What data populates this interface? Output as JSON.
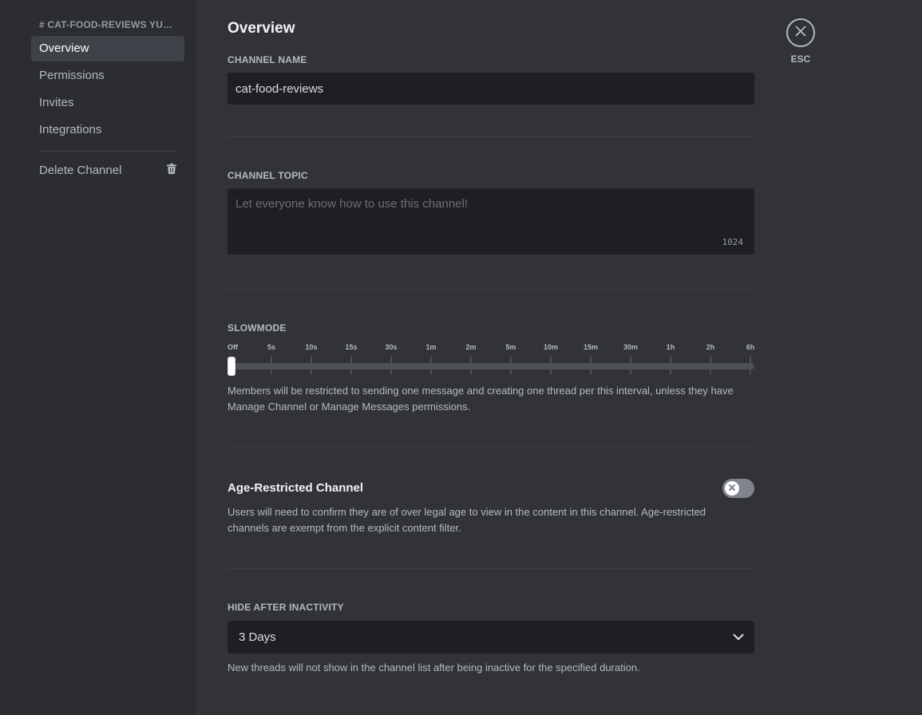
{
  "sidebar": {
    "header": "# CAT-FOOD-REVIEWS YUMMY",
    "items": [
      {
        "label": "Overview",
        "active": true
      },
      {
        "label": "Permissions"
      },
      {
        "label": "Invites"
      },
      {
        "label": "Integrations"
      }
    ],
    "delete_label": "Delete Channel"
  },
  "main": {
    "title": "Overview",
    "channel_name": {
      "label": "CHANNEL NAME",
      "value": "cat-food-reviews"
    },
    "channel_topic": {
      "label": "CHANNEL TOPIC",
      "placeholder": "Let everyone know how to use this channel!",
      "counter": "1024"
    },
    "slowmode": {
      "label": "SLOWMODE",
      "ticks": [
        "Off",
        "5s",
        "10s",
        "15s",
        "30s",
        "1m",
        "2m",
        "5m",
        "10m",
        "15m",
        "30m",
        "1h",
        "2h",
        "6h"
      ],
      "selected_index": 0,
      "description": "Members will be restricted to sending one message and creating one thread per this interval, unless they have Manage Channel or Manage Messages permissions."
    },
    "age_restricted": {
      "title": "Age-Restricted Channel",
      "enabled": false,
      "description": "Users will need to confirm they are of over legal age to view in the content in this channel. Age-restricted channels are exempt from the explicit content filter."
    },
    "hide_after_inactivity": {
      "label": "HIDE AFTER INACTIVITY",
      "value": "3 Days",
      "description": "New threads will not show in the channel list after being inactive for the specified duration."
    }
  },
  "close": {
    "label": "ESC"
  },
  "colors": {
    "background": "#313338",
    "sidebar": "#2b2d31",
    "input": "#1e1f22",
    "accent": "#5865f2"
  }
}
